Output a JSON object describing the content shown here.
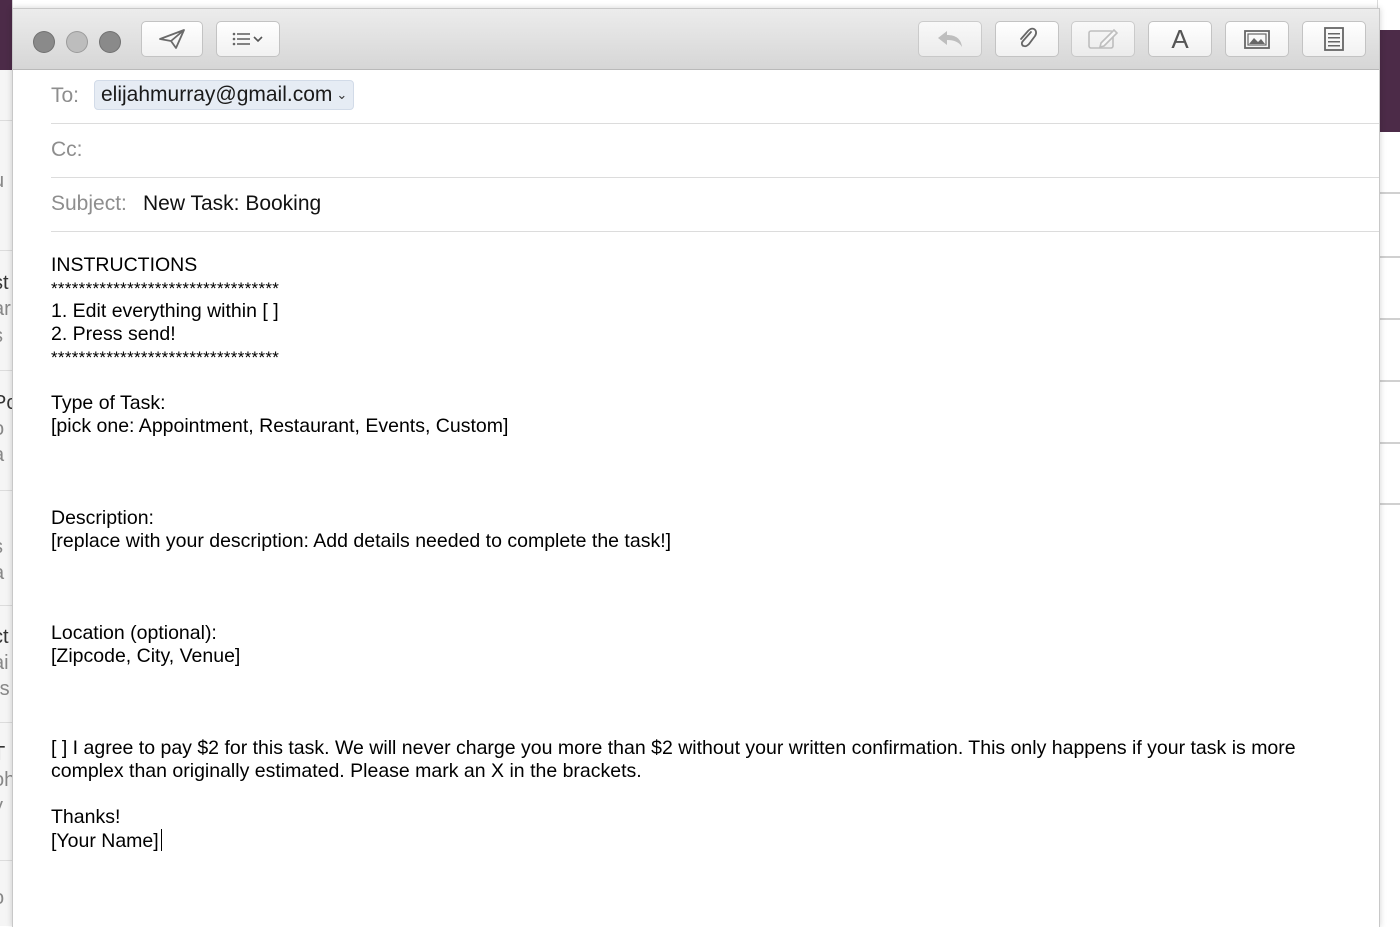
{
  "background_window": {
    "left_fragments": [
      "st",
      "ar",
      "s",
      "Pc",
      "o",
      "a",
      "s",
      "a",
      "ct",
      "ai",
      "rs",
      "T",
      "oh",
      "y",
      "o",
      "u"
    ],
    "accent_color": "#4c2b48"
  },
  "toolbar": {
    "left_buttons": [
      {
        "name": "send-button",
        "icon": "paper-plane-icon"
      },
      {
        "name": "header-fields-button",
        "icon": "list-icon"
      }
    ],
    "right_buttons": [
      {
        "name": "reply-button",
        "icon": "reply-arrow-icon"
      },
      {
        "name": "attach-button",
        "icon": "paperclip-icon"
      },
      {
        "name": "markup-button",
        "icon": "markup-pen-icon"
      },
      {
        "name": "format-button",
        "icon": "font-a-icon",
        "label": "A"
      },
      {
        "name": "photo-browser-button",
        "icon": "photo-icon"
      },
      {
        "name": "stationery-button",
        "icon": "stationery-icon"
      }
    ]
  },
  "header": {
    "to_label": "To:",
    "to_recipient": "elijahmurray@gmail.com",
    "cc_label": "Cc:",
    "cc_value": "",
    "subject_label": "Subject:",
    "subject_value": "New Task: Booking"
  },
  "message": {
    "heading": "INSTRUCTIONS",
    "stars_top": "*********************************",
    "step1": "1. Edit everything within [ ]",
    "step2": "2. Press send!",
    "stars_bottom": "*********************************",
    "type_label": "Type of Task:",
    "type_value": "[pick one: Appointment, Restaurant, Events, Custom]",
    "description_label": "Description:",
    "description_value": "[replace with your description: Add details needed to complete the task!]",
    "location_label": "Location (optional):",
    "location_value": "[Zipcode, City, Venue]",
    "agreement": "[ ] I agree to pay $2 for this task. We will never charge you more than $2 without your written confirmation. This only happens if your task is more complex than originally estimated. Please mark an X in the brackets.",
    "thanks": "Thanks!",
    "signature": "[Your Name]"
  },
  "colors": {
    "chip_bg": "#e6ecf4",
    "label_gray": "#8e8e8e",
    "traffic_light": "#8a8a8a"
  }
}
